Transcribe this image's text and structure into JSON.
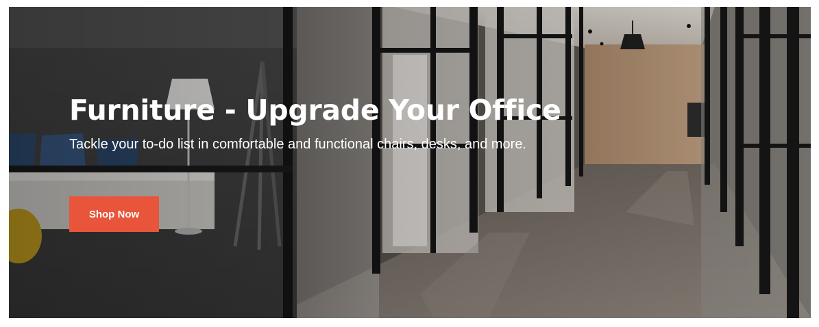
{
  "hero": {
    "title": "Furniture - Upgrade Your Office",
    "subtitle": "Tackle your to-do list in comfortable and functional chairs, desks, and more.",
    "cta_label": "Shop Now",
    "image_subject": "office-hallway-photo",
    "colors": {
      "cta_background": "#e8553a",
      "text": "#ffffff"
    }
  }
}
